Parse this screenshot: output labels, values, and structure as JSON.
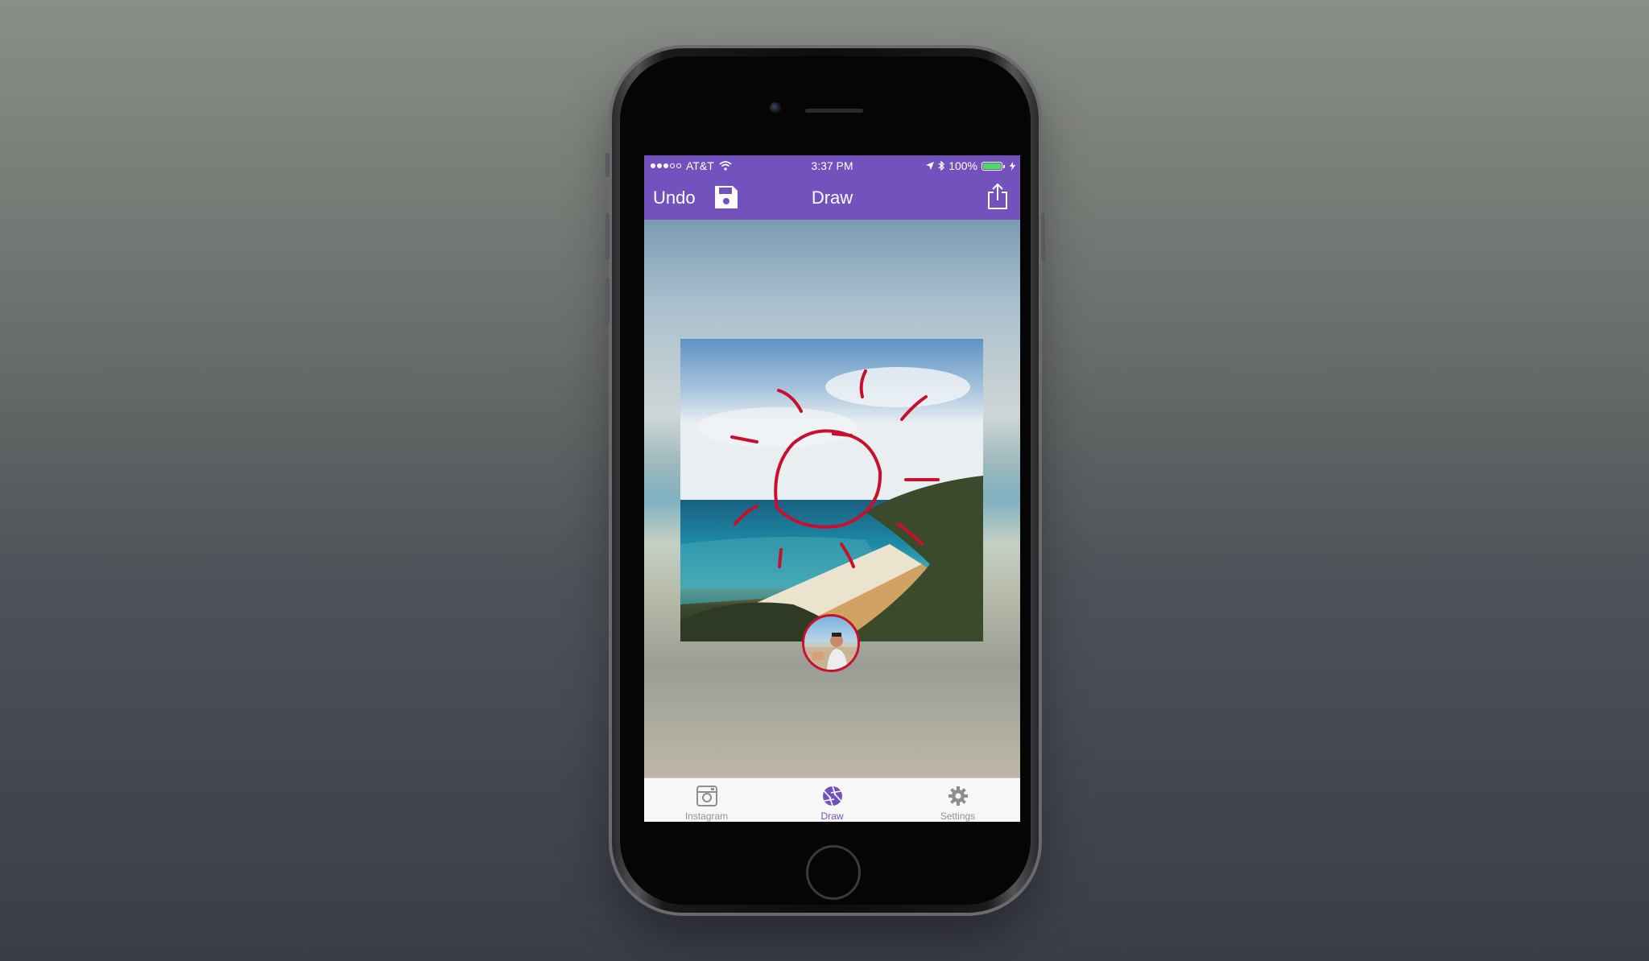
{
  "status_bar": {
    "carrier": "AT&T",
    "time": "3:37 PM",
    "battery_percent": "100%"
  },
  "nav_bar": {
    "undo_label": "Undo",
    "title": "Draw"
  },
  "tabs": [
    {
      "label": "Instagram",
      "active": false
    },
    {
      "label": "Draw",
      "active": true
    },
    {
      "label": "Settings",
      "active": false
    }
  ],
  "colors": {
    "accent": "#7452be",
    "drawing_stroke": "#c8102e"
  },
  "icons": {
    "save": "floppy-disk-icon",
    "share": "share-icon",
    "instagram": "instagram-camera-icon",
    "draw": "aperture-icon",
    "settings": "gear-icon"
  }
}
